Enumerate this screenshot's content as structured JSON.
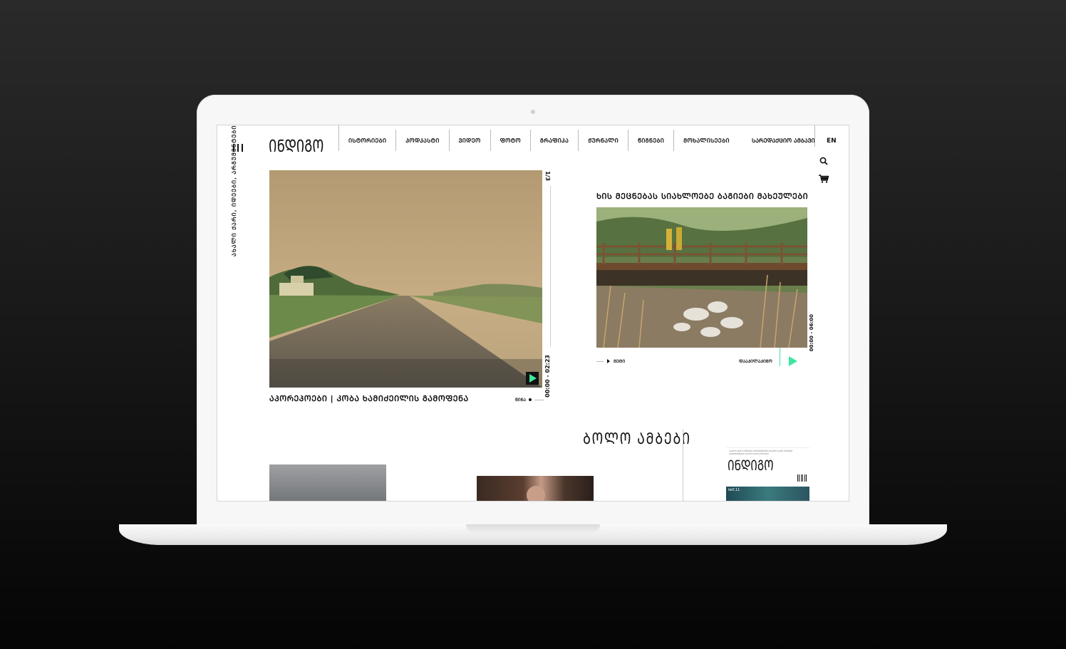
{
  "site": {
    "logo": "ᲘᲜᲓᲘᲒᲝ",
    "tagline": "ᲐᲮᲐᲚᲘ ᲥᲐᲠᲘ, ᲘᲓᲔᲔᲑᲘ, ᲐᲠᲒᲣᲛᲔᲜᲢᲔᲑᲘ",
    "lang": "EN"
  },
  "nav": {
    "items": [
      "ᲘᲡᲢᲝᲠᲘᲔᲑᲘ",
      "ᲞᲝᲓᲙᲐᲡᲢᲘ",
      "ᲕᲘᲓᲔᲝ",
      "ᲤᲝᲢᲝ",
      "ᲒᲠᲐᲤᲘᲙᲐ",
      "ᲟᲣᲠᲜᲐᲚᲘ",
      "ᲬᲘᲒᲜᲔᲑᲘ",
      "ᲛᲝᲮᲐᲚᲘᲡᲔᲔᲑᲘ"
    ],
    "right": "ᲡᲐᲠᲔᲓᲐᲥᲪᲘᲝ ᲐᲛᲑᲐᲕᲘ"
  },
  "hero": {
    "counter": "1/3",
    "time": "00:00 - 02:23",
    "caption": "ᲐᲞᲝᲠᲔᲞᲝᲔᲑᲘ | ᲙᲝᲑᲐ ᲮᲐᲛᲘᲫᲔᲘᲚᲘᲡ ᲒᲐᲛᲝᲤᲔᲜᲐ",
    "next_label": "ᲬᲘᲜᲐ"
  },
  "feature": {
    "title": "ᲮᲘᲡ ᲛᲔᲪᲜᲔᲑᲐᲡ ᲡᲘᲐᲮᲚᲝᲔᲑᲔ ᲑᲐᲒᲘᲔᲑᲘ ᲛᲐᲮᲔᲣᲚᲔᲑᲘ",
    "time": "00:00 - 06:00",
    "more_label": "ᲛᲔᲢᲘ",
    "subscribe_label": "ᲓᲐᲐᲞᲘᲚᲐᲞᲘᲒᲝ"
  },
  "news": {
    "title": "ᲑᲝᲚᲝ ᲐᲛᲑᲔᲑᲘ"
  },
  "magazine": {
    "blurb": "ᲐᲮᲐᲚᲘ ᲥᲐᲠᲘ ᲘᲓᲔᲔᲑᲘ ᲐᲠᲒᲣᲛᲔᲜᲢᲔᲑᲘ ᲐᲮᲐᲚᲘ ᲥᲐᲠᲘ ᲘᲓᲔᲔᲑᲘ ᲐᲠᲒᲣᲛᲔᲜᲢᲔᲑᲘ ᲐᲮᲐᲚᲘ ᲥᲐᲠᲘ ᲘᲓᲔᲔᲑᲘ",
    "logo": "ᲘᲜᲓᲘᲒᲝ",
    "issue": "№0.11"
  },
  "icons": {
    "search": "search-icon",
    "cart": "cart-icon",
    "menu": "hamburger-icon",
    "play": "play-icon"
  },
  "colors": {
    "accent": "#3ee6a0",
    "text": "#111111",
    "background": "#ffffff"
  }
}
